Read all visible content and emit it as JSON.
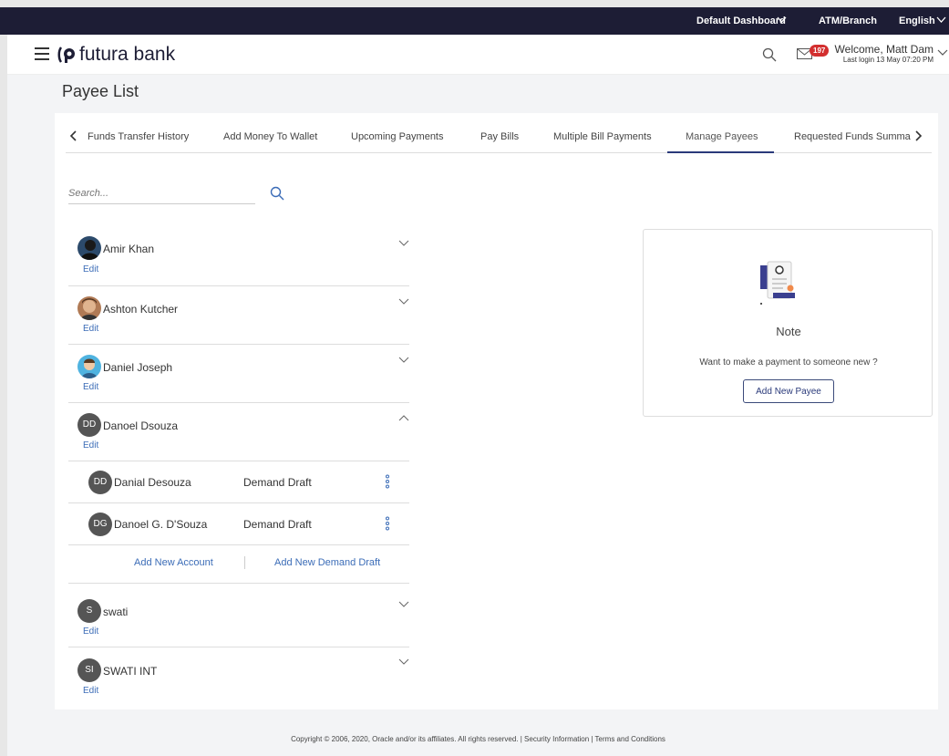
{
  "topbar": {
    "dashboard": "Default Dashboard",
    "atm": "ATM/Branch",
    "language": "English"
  },
  "header": {
    "brand": "futura bank",
    "mail_count": "197",
    "welcome": "Welcome, Matt Dam",
    "last_login": "Last login 13 May 07:20 PM"
  },
  "page": {
    "title": "Payee List"
  },
  "tabs": [
    {
      "label": "Funds Transfer History"
    },
    {
      "label": "Add Money To Wallet"
    },
    {
      "label": "Upcoming Payments"
    },
    {
      "label": "Pay Bills"
    },
    {
      "label": "Multiple Bill Payments"
    },
    {
      "label": "Manage Payees"
    },
    {
      "label": "Requested Funds Summa"
    }
  ],
  "search": {
    "placeholder": "Search..."
  },
  "payees": [
    {
      "name": "Amir Khan",
      "edit": "Edit"
    },
    {
      "name": "Ashton Kutcher",
      "edit": "Edit"
    },
    {
      "name": "Daniel Joseph",
      "edit": "Edit"
    },
    {
      "name": "Danoel Dsouza",
      "initials": "DD",
      "edit": "Edit"
    },
    {
      "name": "swati",
      "initials": "S",
      "edit": "Edit"
    },
    {
      "name": "SWATI INT",
      "initials": "SI",
      "edit": "Edit"
    }
  ],
  "accounts": [
    {
      "initials": "DD",
      "name": "Danial Desouza",
      "type": "Demand Draft"
    },
    {
      "initials": "DG",
      "name": "Danoel G. D'Souza",
      "type": "Demand Draft"
    }
  ],
  "add_links": {
    "account": "Add New Account",
    "draft": "Add New Demand Draft"
  },
  "note": {
    "title": "Note",
    "description": "Want to make a payment to someone new ?",
    "button": "Add New Payee"
  },
  "footer": {
    "text": "Copyright © 2006, 2020, Oracle and/or its affiliates. All rights reserved. | Security Information | Terms and Conditions"
  }
}
